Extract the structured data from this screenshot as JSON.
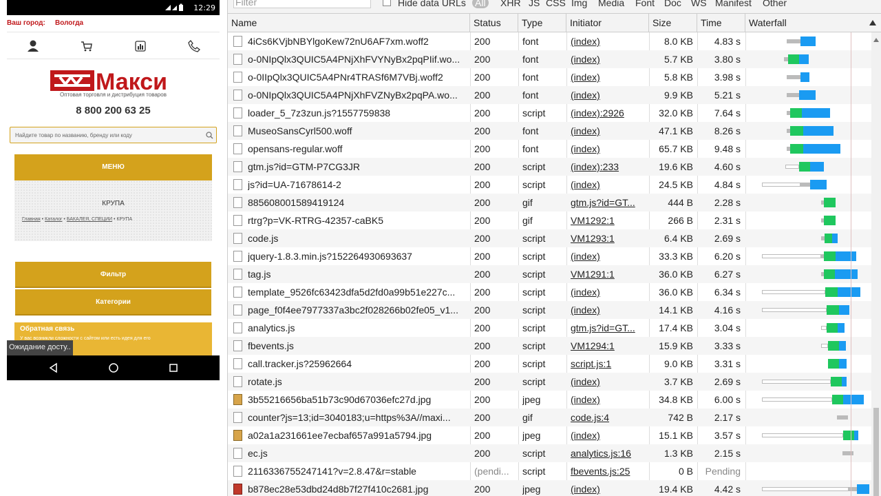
{
  "phone": {
    "status_time": "12:29",
    "city_label": "Ваш город:",
    "city_value": "Вологда",
    "brand": "Макси",
    "tagline": "Оптовая торговля и дистрибуция товаров",
    "phone_number": "8 800 200 63 25",
    "search_placeholder": "Найдите товар по названию, бренду или коду",
    "menu_label": "МЕНЮ",
    "category_title": "КРУПА",
    "breadcrumb": [
      "Главная",
      "Каталог",
      "БАКАЛЕЯ, СПЕЦИИ",
      "КРУПА"
    ],
    "filter_label": "Фильтр",
    "categories_label": "Категории",
    "feedback_title": "Обратная связь",
    "feedback_text": "У вас возникли сложности с сайтом или есть идея для его",
    "toast": "Ожидание досту.."
  },
  "devtools": {
    "filter_placeholder": "Filter",
    "hide_data_urls": "Hide data URLs",
    "type_filters": [
      "All",
      "XHR",
      "JS",
      "CSS",
      "Img",
      "Media",
      "Font",
      "Doc",
      "WS",
      "Manifest",
      "Other"
    ],
    "selected_filter": "All",
    "columns": [
      "Name",
      "Status",
      "Type",
      "Initiator",
      "Size",
      "Time",
      "Waterfall"
    ],
    "rows": [
      {
        "name": "4iCs6KVjbNBYlgoKew72nU6AF7xm.woff2",
        "status": "200",
        "type": "font",
        "initiator": "(index)",
        "size": "8.0 KB",
        "time": "4.83 s",
        "icon": "doc",
        "wf": {
          "wait": [
            0,
            0
          ],
          "q": [
            40,
            60
          ],
          "g": [
            0,
            0
          ],
          "b": [
            60,
            82
          ]
        }
      },
      {
        "name": "o-0NIpQlx3QUIC5A4PNjXhFVYNyBx2pqPIif.wo...",
        "status": "200",
        "type": "font",
        "initiator": "(index)",
        "size": "5.7 KB",
        "time": "3.80 s",
        "icon": "doc",
        "wf": {
          "wait": [
            0,
            0
          ],
          "q": [
            36,
            42
          ],
          "g": [
            42,
            58
          ],
          "b": [
            58,
            72
          ]
        }
      },
      {
        "name": "o-0IIpQlx3QUIC5A4PNr4TRASf6M7VBj.woff2",
        "status": "200",
        "type": "font",
        "initiator": "(index)",
        "size": "5.8 KB",
        "time": "3.98 s",
        "icon": "doc",
        "wf": {
          "wait": [
            0,
            0
          ],
          "q": [
            40,
            60
          ],
          "g": [
            0,
            0
          ],
          "b": [
            60,
            73
          ]
        }
      },
      {
        "name": "o-0NIpQlx3QUIC5A4PNjXhFVZNyBx2pqPA.wo...",
        "status": "200",
        "type": "font",
        "initiator": "(index)",
        "size": "9.9 KB",
        "time": "5.21 s",
        "icon": "doc",
        "wf": {
          "wait": [
            0,
            0
          ],
          "q": [
            40,
            58
          ],
          "g": [
            0,
            0
          ],
          "b": [
            58,
            82
          ]
        }
      },
      {
        "name": "loader_5_7z3zun.js?1557759838",
        "status": "200",
        "type": "script",
        "initiator": "(index):2926",
        "size": "32.0 KB",
        "time": "7.64 s",
        "icon": "doc",
        "wf": {
          "wait": [
            0,
            0
          ],
          "q": [
            40,
            45
          ],
          "g": [
            45,
            62
          ],
          "b": [
            62,
            103
          ]
        }
      },
      {
        "name": "MuseoSansCyrl500.woff",
        "status": "200",
        "type": "font",
        "initiator": "(index)",
        "size": "47.1 KB",
        "time": "8.26 s",
        "icon": "doc",
        "wf": {
          "wait": [
            0,
            0
          ],
          "q": [
            40,
            45
          ],
          "g": [
            45,
            64
          ],
          "b": [
            64,
            108
          ]
        }
      },
      {
        "name": "opensans-regular.woff",
        "status": "200",
        "type": "font",
        "initiator": "(index)",
        "size": "65.7 KB",
        "time": "9.48 s",
        "icon": "doc",
        "wf": {
          "wait": [
            0,
            0
          ],
          "q": [
            40,
            45
          ],
          "g": [
            45,
            64
          ],
          "b": [
            64,
            118
          ]
        }
      },
      {
        "name": "gtm.js?id=GTM-P7CG3JR",
        "status": "200",
        "type": "script",
        "initiator": "(index):233",
        "size": "19.6 KB",
        "time": "4.60 s",
        "icon": "doc",
        "wf": {
          "wait": [
            38,
            58
          ],
          "q": [
            0,
            0
          ],
          "g": [
            58,
            74
          ],
          "b": [
            74,
            94
          ]
        }
      },
      {
        "name": "js?id=UA-71678614-2",
        "status": "200",
        "type": "script",
        "initiator": "(index)",
        "size": "24.5 KB",
        "time": "4.84 s",
        "icon": "doc",
        "wf": {
          "wait": [
            4,
            60
          ],
          "q": [
            60,
            74
          ],
          "g": [
            0,
            0
          ],
          "b": [
            74,
            98
          ]
        }
      },
      {
        "name": "885608001589419124",
        "status": "200",
        "type": "gif",
        "initiator": "gtm.js?id=GT...",
        "size": "444 B",
        "time": "2.28 s",
        "icon": "doc",
        "wf": {
          "wait": [
            0,
            0
          ],
          "q": [
            90,
            94
          ],
          "g": [
            94,
            111
          ],
          "b": [
            0,
            0
          ]
        }
      },
      {
        "name": "rtrg?p=VK-RTRG-42357-caBK5",
        "status": "200",
        "type": "gif",
        "initiator": "VM1292:1",
        "size": "266 B",
        "time": "2.31 s",
        "icon": "doc",
        "wf": {
          "wait": [
            0,
            0
          ],
          "q": [
            90,
            94
          ],
          "g": [
            94,
            111
          ],
          "b": [
            0,
            0
          ]
        }
      },
      {
        "name": "code.js",
        "status": "200",
        "type": "script",
        "initiator": "VM1293:1",
        "size": "6.4 KB",
        "time": "2.69 s",
        "icon": "doc",
        "wf": {
          "wait": [
            0,
            0
          ],
          "q": [
            90,
            95
          ],
          "g": [
            95,
            106
          ],
          "b": [
            106,
            114
          ]
        }
      },
      {
        "name": "jquery-1.8.3.min.js?152264930693637",
        "status": "200",
        "type": "script",
        "initiator": "(index)",
        "size": "33.3 KB",
        "time": "6.20 s",
        "icon": "doc",
        "wf": {
          "wait": [
            4,
            90
          ],
          "q": [
            90,
            94
          ],
          "g": [
            94,
            111
          ],
          "b": [
            111,
            141
          ]
        }
      },
      {
        "name": "tag.js",
        "status": "200",
        "type": "script",
        "initiator": "VM1291:1",
        "size": "36.0 KB",
        "time": "6.27 s",
        "icon": "doc",
        "wf": {
          "wait": [
            0,
            0
          ],
          "q": [
            90,
            94
          ],
          "g": [
            94,
            110
          ],
          "b": [
            110,
            143
          ]
        }
      },
      {
        "name": "template_9526fc63423dfa5d2fd0a99b51e227c...",
        "status": "200",
        "type": "script",
        "initiator": "(index)",
        "size": "36.0 KB",
        "time": "6.34 s",
        "icon": "doc",
        "wf": {
          "wait": [
            4,
            96
          ],
          "q": [
            0,
            0
          ],
          "g": [
            96,
            114
          ],
          "b": [
            114,
            147
          ]
        }
      },
      {
        "name": "page_f0f4ee7977337a3bc2f028266b02fe05_v1...",
        "status": "200",
        "type": "script",
        "initiator": "(index)",
        "size": "14.1 KB",
        "time": "4.16 s",
        "icon": "doc",
        "wf": {
          "wait": [
            4,
            98
          ],
          "q": [
            0,
            0
          ],
          "g": [
            98,
            116
          ],
          "b": [
            116,
            131
          ]
        }
      },
      {
        "name": "analytics.js",
        "status": "200",
        "type": "script",
        "initiator": "gtm.js?id=GT...",
        "size": "17.4 KB",
        "time": "3.04 s",
        "icon": "doc",
        "wf": {
          "wait": [
            90,
            98
          ],
          "q": [
            0,
            0
          ],
          "g": [
            98,
            114
          ],
          "b": [
            114,
            124
          ]
        }
      },
      {
        "name": "fbevents.js",
        "status": "200",
        "type": "script",
        "initiator": "VM1294:1",
        "size": "15.9 KB",
        "time": "3.33 s",
        "icon": "doc",
        "wf": {
          "wait": [
            90,
            100
          ],
          "q": [
            0,
            0
          ],
          "g": [
            100,
            116
          ],
          "b": [
            116,
            126
          ]
        }
      },
      {
        "name": "call.tracker.js?25962664",
        "status": "200",
        "type": "script",
        "initiator": "script.js:1",
        "size": "9.0 KB",
        "time": "3.31 s",
        "icon": "doc",
        "wf": {
          "wait": [
            0,
            0
          ],
          "q": [
            0,
            0
          ],
          "g": [
            100,
            116
          ],
          "b": [
            116,
            127
          ]
        }
      },
      {
        "name": "rotate.js",
        "status": "200",
        "type": "script",
        "initiator": "(index)",
        "size": "3.7 KB",
        "time": "2.69 s",
        "icon": "doc",
        "wf": {
          "wait": [
            4,
            104
          ],
          "q": [
            0,
            0
          ],
          "g": [
            104,
            120
          ],
          "b": [
            120,
            127
          ]
        }
      },
      {
        "name": "3b55216656ba51b73c90d67036efc27d.jpg",
        "status": "200",
        "type": "jpeg",
        "initiator": "(index)",
        "size": "34.8 KB",
        "time": "6.00 s",
        "icon": "img",
        "wf": {
          "wait": [
            4,
            106
          ],
          "q": [
            0,
            0
          ],
          "g": [
            106,
            122
          ],
          "b": [
            122,
            152
          ]
        }
      },
      {
        "name": "counter?js=13;id=3040183;u=https%3A//maxi...",
        "status": "200",
        "type": "gif",
        "initiator": "code.js:4",
        "size": "742 B",
        "time": "2.17 s",
        "icon": "doc",
        "wf": {
          "wait": [
            0,
            0
          ],
          "q": [
            113,
            129
          ],
          "g": [
            0,
            0
          ],
          "b": [
            0,
            0
          ]
        }
      },
      {
        "name": "a02a1a231661ee7ecbaf657a991a5794.jpg",
        "status": "200",
        "type": "jpeg",
        "initiator": "(index)",
        "size": "15.1 KB",
        "time": "3.57 s",
        "icon": "img",
        "wf": {
          "wait": [
            4,
            122
          ],
          "q": [
            0,
            0
          ],
          "g": [
            122,
            138
          ],
          "b": [
            138,
            144
          ]
        }
      },
      {
        "name": "ec.js",
        "status": "200",
        "type": "script",
        "initiator": "analytics.js:16",
        "size": "1.3 KB",
        "time": "2.15 s",
        "icon": "doc",
        "wf": {
          "wait": [
            0,
            0
          ],
          "q": [
            121,
            137
          ],
          "g": [
            0,
            0
          ],
          "b": [
            0,
            0
          ]
        }
      },
      {
        "name": "2116336755247141?v=2.8.47&r=stable",
        "status": "(pendi...",
        "type": "script",
        "initiator": "fbevents.js:25",
        "size": "0 B",
        "time": "Pending",
        "icon": "doc",
        "wf": {
          "wait": [
            0,
            0
          ],
          "q": [
            0,
            0
          ],
          "g": [
            0,
            0
          ],
          "b": [
            0,
            0
          ]
        }
      },
      {
        "name": "b878ec28e53dbd24d8b7f27f410c2681.jpg",
        "status": "200",
        "type": "jpeg",
        "initiator": "(index)",
        "size": "19.4 KB",
        "time": "4.42 s",
        "icon": "img-red",
        "wf": {
          "wait": [
            4,
            130
          ],
          "q": [
            130,
            142
          ],
          "g": [
            0,
            0
          ],
          "b": [
            142,
            160
          ]
        }
      }
    ]
  }
}
